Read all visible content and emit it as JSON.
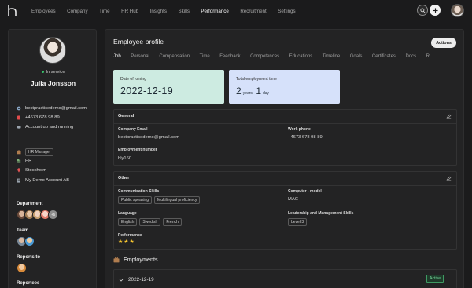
{
  "nav": {
    "items": [
      "Employees",
      "Company",
      "Time",
      "HR Hub",
      "Insights",
      "Skills",
      "Performance",
      "Recruitment",
      "Settings"
    ],
    "active": "Performance"
  },
  "profile": {
    "status": "In service",
    "name": "Julia Jonsson",
    "email": "bestpracticedemo@gmail.com",
    "phone": "+4673 678 98 89",
    "account_status": "Account up and running",
    "role": "HR Manager",
    "department": "HR",
    "location": "Stockholm",
    "company": "My Demo Account AB"
  },
  "left_sections": {
    "department": "Department",
    "department_more": "+5",
    "team": "Team",
    "reports_to": "Reports to",
    "reportees": "Reportees"
  },
  "main": {
    "title": "Employee profile",
    "actions_label": "Actions",
    "tabs": [
      "Job",
      "Personal",
      "Compensation",
      "Time",
      "Feedback",
      "Competences",
      "Educations",
      "Timeline",
      "Goals",
      "Certificates",
      "Docs",
      "Ri"
    ],
    "active_tab": "Job"
  },
  "tiles": {
    "joining_label": "Date of joining",
    "joining_value": "2022-12-19",
    "employment_label": "Total employment time",
    "years_value": "2",
    "years_unit": "years,",
    "days_value": "1",
    "days_unit": "day"
  },
  "general": {
    "title": "General",
    "company_email_label": "Company Email",
    "company_email_value": "bestpracticedemo@gmail.com",
    "work_phone_label": "Work phone",
    "work_phone_value": "+4673 678 98 89",
    "employment_number_label": "Employment number",
    "employment_number_value": "hly160"
  },
  "other": {
    "title": "Other",
    "communication_label": "Communication Skills",
    "communication_chips": [
      "Public speaking",
      "Multilingual proficiency"
    ],
    "computer_label": "Computer - model",
    "computer_value": "MAC",
    "language_label": "Language",
    "language_chips": [
      "English",
      "Swedish",
      "French"
    ],
    "leadership_label": "Leadership and Management Skills",
    "leadership_chips": [
      "Level 3"
    ],
    "performance_label": "Performance",
    "performance_stars": "★★★"
  },
  "employments": {
    "title": "Employments",
    "date": "2022-12-19",
    "badge": "Active"
  },
  "colors": {
    "accent_green_tile": "#cdebe1",
    "accent_blue_tile": "#d6e1fa",
    "status_active": "#37c06a",
    "star": "#f4c430"
  }
}
